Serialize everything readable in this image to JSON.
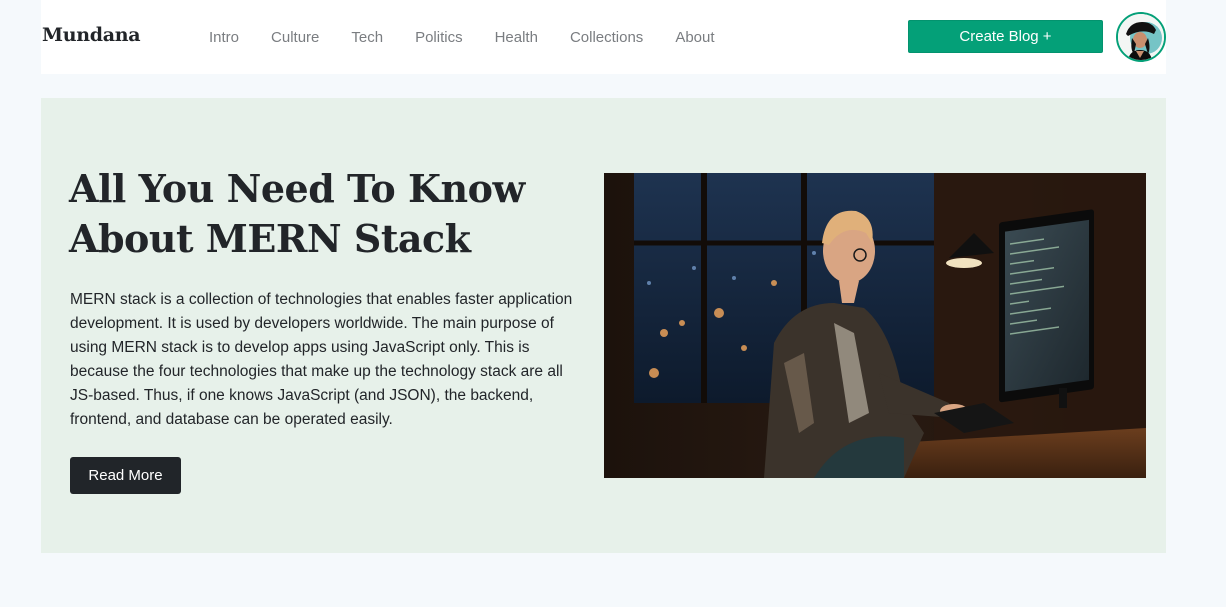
{
  "brand": "Mundana",
  "nav": {
    "links": [
      "Intro",
      "Culture",
      "Tech",
      "Politics",
      "Health",
      "Collections",
      "About"
    ],
    "create_label": "Create Blog +"
  },
  "user": {
    "avatar": "user-avatar-icon"
  },
  "hero": {
    "title": "All You Need To Know About MERN Stack",
    "description": "MERN stack is a collection of technologies that enables faster application development. It is used by developers worldwide. The main purpose of using MERN stack is to develop apps using JavaScript only. This is because the four technologies that make up the technology stack are all JS-based. Thus, if one knows JavaScript (and JSON), the backend, frontend, and database can be operated easily.",
    "button_label": "Read More"
  },
  "colors": {
    "accent": "#04a078",
    "hero_background": "#e7f1ea",
    "page_background": "#f5f9fc",
    "dark_button": "#212529"
  }
}
